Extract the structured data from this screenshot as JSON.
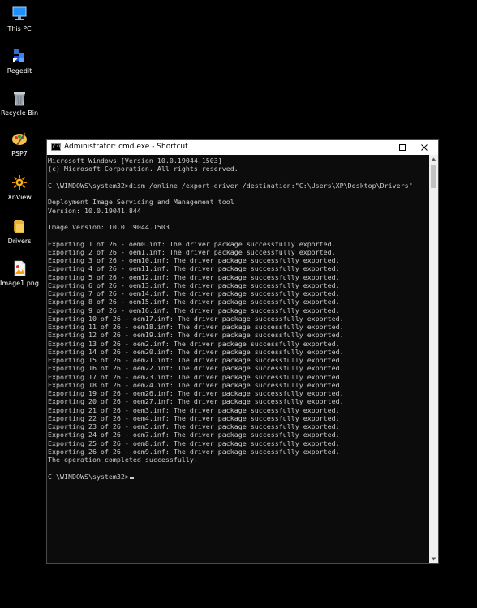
{
  "desktop": {
    "icons": [
      {
        "label": "This PC",
        "icon": "computer-icon"
      },
      {
        "label": "Regedit",
        "icon": "registry-icon"
      },
      {
        "label": "Recycle Bin",
        "icon": "recycle-bin-icon"
      },
      {
        "label": "PSP7",
        "icon": "paint-shop-pro-icon"
      },
      {
        "label": "XnView",
        "icon": "xnview-icon"
      },
      {
        "label": "Drivers",
        "icon": "folder-icon"
      },
      {
        "label": "Image1.png",
        "icon": "image-file-icon"
      }
    ]
  },
  "window": {
    "title": "Administrator: cmd.exe - Shortcut",
    "app_icon_text": "C:\\",
    "controls": {
      "minimize": "minimize-icon",
      "maximize": "maximize-icon",
      "close": "close-icon"
    }
  },
  "console": {
    "lines": [
      "Microsoft Windows [Version 10.0.19044.1503]",
      "(c) Microsoft Corporation. All rights reserved.",
      "",
      "C:\\WINDOWS\\system32>dism /online /export-driver /destination:\"C:\\Users\\XP\\Desktop\\Drivers\"",
      "",
      "Deployment Image Servicing and Management tool",
      "Version: 10.0.19041.844",
      "",
      "Image Version: 10.0.19044.1503",
      "",
      "Exporting 1 of 26 - oem0.inf: The driver package successfully exported.",
      "Exporting 2 of 26 - oem1.inf: The driver package successfully exported.",
      "Exporting 3 of 26 - oem10.inf: The driver package successfully exported.",
      "Exporting 4 of 26 - oem11.inf: The driver package successfully exported.",
      "Exporting 5 of 26 - oem12.inf: The driver package successfully exported.",
      "Exporting 6 of 26 - oem13.inf: The driver package successfully exported.",
      "Exporting 7 of 26 - oem14.inf: The driver package successfully exported.",
      "Exporting 8 of 26 - oem15.inf: The driver package successfully exported.",
      "Exporting 9 of 26 - oem16.inf: The driver package successfully exported.",
      "Exporting 10 of 26 - oem17.inf: The driver package successfully exported.",
      "Exporting 11 of 26 - oem18.inf: The driver package successfully exported.",
      "Exporting 12 of 26 - oem19.inf: The driver package successfully exported.",
      "Exporting 13 of 26 - oem2.inf: The driver package successfully exported.",
      "Exporting 14 of 26 - oem20.inf: The driver package successfully exported.",
      "Exporting 15 of 26 - oem21.inf: The driver package successfully exported.",
      "Exporting 16 of 26 - oem22.inf: The driver package successfully exported.",
      "Exporting 17 of 26 - oem23.inf: The driver package successfully exported.",
      "Exporting 18 of 26 - oem24.inf: The driver package successfully exported.",
      "Exporting 19 of 26 - oem26.inf: The driver package successfully exported.",
      "Exporting 20 of 26 - oem27.inf: The driver package successfully exported.",
      "Exporting 21 of 26 - oem3.inf: The driver package successfully exported.",
      "Exporting 22 of 26 - oem4.inf: The driver package successfully exported.",
      "Exporting 23 of 26 - oem5.inf: The driver package successfully exported.",
      "Exporting 24 of 26 - oem7.inf: The driver package successfully exported.",
      "Exporting 25 of 26 - oem8.inf: The driver package successfully exported.",
      "Exporting 26 of 26 - oem9.inf: The driver package successfully exported.",
      "The operation completed successfully.",
      ""
    ],
    "prompt": "C:\\WINDOWS\\system32>"
  },
  "colors": {
    "desktop_background": "#000000",
    "console_background": "#0c0c0c",
    "console_text": "#cccccc",
    "titlebar_background": "#ffffff"
  }
}
